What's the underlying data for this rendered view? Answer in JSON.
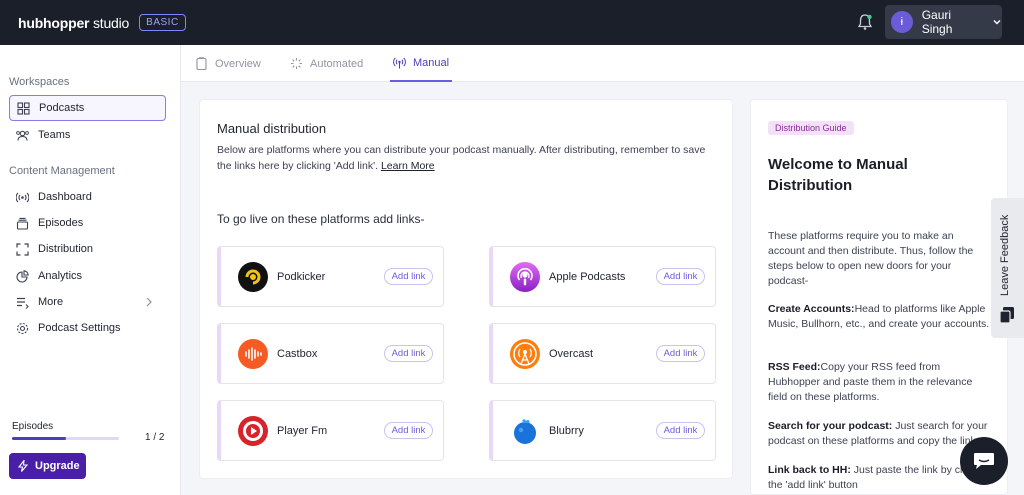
{
  "brand": {
    "name_bold": "hubhopper",
    "name_thin": " studio",
    "plan": "BASIC"
  },
  "user": {
    "avatar": "ɨ",
    "name": "Gauri Singh"
  },
  "sidebar": {
    "workspaces_heading": "Workspaces",
    "workspaces": [
      {
        "label": "Podcasts",
        "icon": "grid-icon"
      },
      {
        "label": "Teams",
        "icon": "team-icon"
      }
    ],
    "content_heading": "Content Management",
    "content": [
      {
        "label": "Dashboard",
        "icon": "broadcast-icon"
      },
      {
        "label": "Episodes",
        "icon": "layers-icon"
      },
      {
        "label": "Distribution",
        "icon": "expand-icon"
      },
      {
        "label": "Analytics",
        "icon": "pie-chart-icon"
      },
      {
        "label": "More",
        "icon": "list-icon"
      },
      {
        "label": "Podcast Settings",
        "icon": "gear-icon"
      }
    ],
    "episodes_label": "Episodes",
    "episodes_count": "1 / 2",
    "episodes_progress": 0.5,
    "upgrade_label": "Upgrade"
  },
  "tabs": [
    {
      "label": "Overview",
      "icon": "clipboard-icon"
    },
    {
      "label": "Automated",
      "icon": "sparkle-icon"
    },
    {
      "label": "Manual",
      "icon": "antenna-icon"
    }
  ],
  "main": {
    "title": "Manual distribution",
    "description": "Below are platforms where you can distribute your podcast manually. After distributing, remember to save the links here by clicking 'Add link'.",
    "learn_more": "Learn More",
    "subheading": "To go live on these platforms add links-",
    "add_link_label": "Add link",
    "platforms": [
      {
        "name": "Podkicker",
        "icon": "podkicker-icon"
      },
      {
        "name": "Apple Podcasts",
        "icon": "apple-podcasts-icon"
      },
      {
        "name": "Castbox",
        "icon": "castbox-icon"
      },
      {
        "name": "Overcast",
        "icon": "overcast-icon"
      },
      {
        "name": "Player Fm",
        "icon": "player-fm-icon"
      },
      {
        "name": "Blubrry",
        "icon": "blubrry-icon"
      }
    ]
  },
  "guide": {
    "badge": "Distribution Guide",
    "title": "Welcome to Manual Distribution",
    "intro": "These platforms require you to make an account and then distribute. Thus, follow the steps below to open new doors for your podcast-",
    "steps": [
      {
        "title": "Create Accounts:",
        "text": "Head to platforms like Apple Music, Bullhorn, etc., and create your accounts."
      },
      {
        "title": "RSS Feed:",
        "text": "Copy your RSS feed from Hubhopper and paste them in the relevance field on these platforms."
      },
      {
        "title": "Search for your podcast:",
        "text": " Just search for your podcast on these platforms and copy the link."
      },
      {
        "title": "Link back to HH:",
        "text": " Just paste the link by clicking the 'add link' button"
      }
    ]
  },
  "feedback_label": "Leave Feedback",
  "colors": {
    "accent": "#6a5ee0",
    "topbar": "#1b1f2a",
    "upgrade": "#4a1fa8"
  }
}
